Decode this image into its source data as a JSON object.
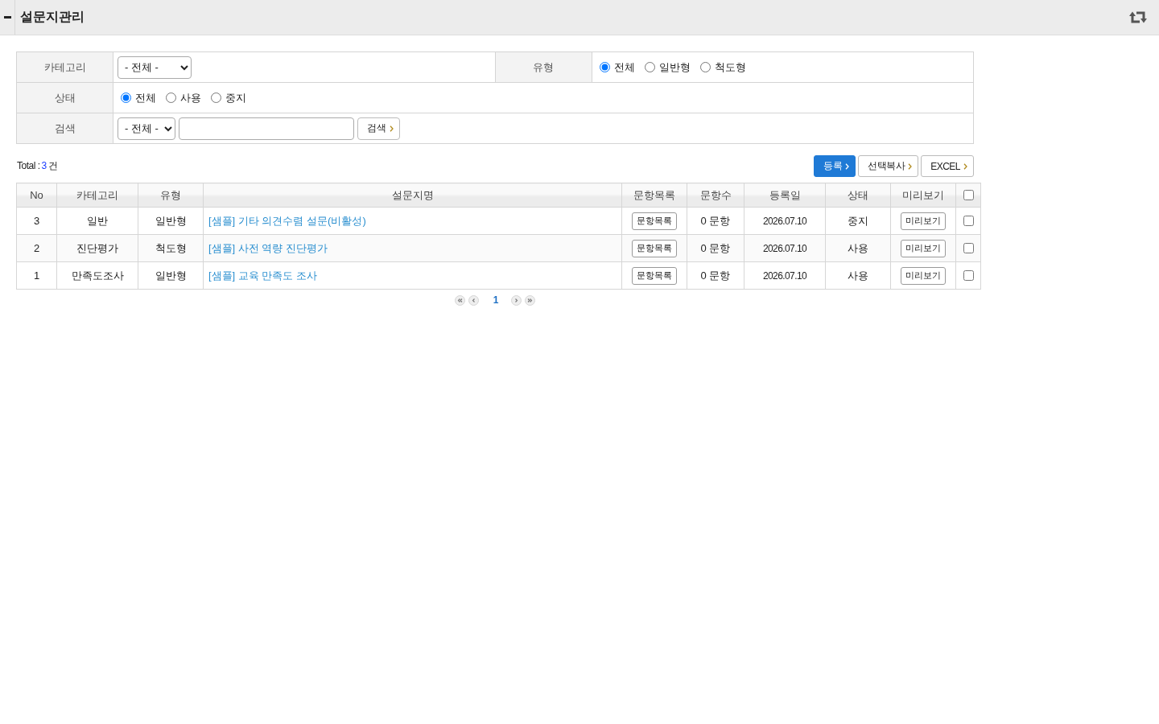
{
  "header": {
    "title": "설문지관리"
  },
  "filters": {
    "category": {
      "label": "카테고리",
      "value": "- 전체 -"
    },
    "type": {
      "label": "유형",
      "options": [
        {
          "label": "전체",
          "selected": true
        },
        {
          "label": "일반형",
          "selected": false
        },
        {
          "label": "척도형",
          "selected": false
        }
      ]
    },
    "status": {
      "label": "상태",
      "options": [
        {
          "label": "전체",
          "selected": true
        },
        {
          "label": "사용",
          "selected": false
        },
        {
          "label": "중지",
          "selected": false
        }
      ]
    },
    "search": {
      "label": "검색",
      "scope": "- 전체 -",
      "button": "검색"
    }
  },
  "summary": {
    "label": "Total :",
    "count": "3",
    "unit": "건"
  },
  "actions": [
    {
      "label": "등록",
      "kind": "primary"
    },
    {
      "label": "선택복사",
      "kind": "default"
    },
    {
      "label": "EXCEL",
      "kind": "default"
    }
  ],
  "table": {
    "columns": [
      "No",
      "카테고리",
      "유형",
      "설문지명",
      "문항목록",
      "문항수",
      "등록일",
      "상태",
      "미리보기"
    ],
    "select_all_checked": false,
    "rows": [
      {
        "no": "3",
        "category": "일반",
        "type": "일반형",
        "title": "[샘플] 기타 의견수렴 설문(비활성)",
        "items_button": "문항목록",
        "item_count": "0 문항",
        "date": "2026.07.10",
        "status": "중지",
        "preview_button": "미리보기",
        "checked": false
      },
      {
        "no": "2",
        "category": "진단평가",
        "type": "척도형",
        "title": "[샘플] 사전 역량 진단평가",
        "items_button": "문항목록",
        "item_count": "0 문항",
        "date": "2026.07.10",
        "status": "사용",
        "preview_button": "미리보기",
        "checked": false
      },
      {
        "no": "1",
        "category": "만족도조사",
        "type": "일반형",
        "title": "[샘플] 교육 만족도 조사",
        "items_button": "문항목록",
        "item_count": "0 문항",
        "date": "2026.07.10",
        "status": "사용",
        "preview_button": "미리보기",
        "checked": false
      }
    ]
  },
  "pagination": {
    "pages": [
      {
        "label": "1",
        "selected": true
      }
    ]
  }
}
